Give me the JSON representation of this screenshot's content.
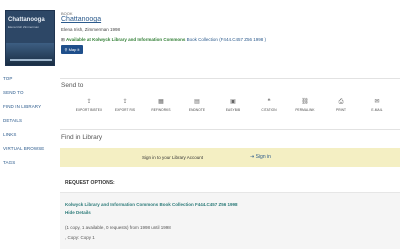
{
  "record": {
    "type": "BOOK",
    "title": "Chattanooga",
    "authors": "Elena Irish, Zimmerman 1998",
    "avail_status": "Available at Kolwyck Library and Information Commons",
    "avail_collection": "Book Collection (F444.C457 Z56 1998 )",
    "map_label": "Map it"
  },
  "cover": {
    "title": "Chattanooga",
    "subtitle": "Elena Irish Zimmerman"
  },
  "sidebar": {
    "items": [
      "TOP",
      "SEND TO",
      "FIND IN LIBRARY",
      "DETAILS",
      "LINKS",
      "VIRTUAL BROWSE",
      "TAGS"
    ]
  },
  "send_to": {
    "title": "Send to",
    "actions": [
      {
        "label": "EXPORT BIBTEX",
        "icon": "export-icon"
      },
      {
        "label": "EXPORT RIS",
        "icon": "export-icon"
      },
      {
        "label": "REFWORKS",
        "icon": "refworks-icon"
      },
      {
        "label": "ENDNOTE",
        "icon": "endnote-icon"
      },
      {
        "label": "EASYBIB",
        "icon": "easybib-icon"
      },
      {
        "label": "CITATION",
        "icon": "quote-icon"
      },
      {
        "label": "PERMALINK",
        "icon": "link-icon"
      },
      {
        "label": "PRINT",
        "icon": "print-icon"
      },
      {
        "label": "E-MAIL",
        "icon": "mail-icon"
      }
    ]
  },
  "find_in_library": {
    "title": "Find in Library",
    "sign_text": "Sign in to your Library Account",
    "sign_link": "Sign in"
  },
  "request": {
    "title": "REQUEST OPTIONS:",
    "location": "Kolwyck Library and Information Commons   Book Collection   F444.C457 Z56 1998",
    "hide": "Hide Details",
    "copies": "(1 copy, 1 available, 0 requests) from 1998 until 1998",
    "copy": ", Copy: Copy 1"
  }
}
